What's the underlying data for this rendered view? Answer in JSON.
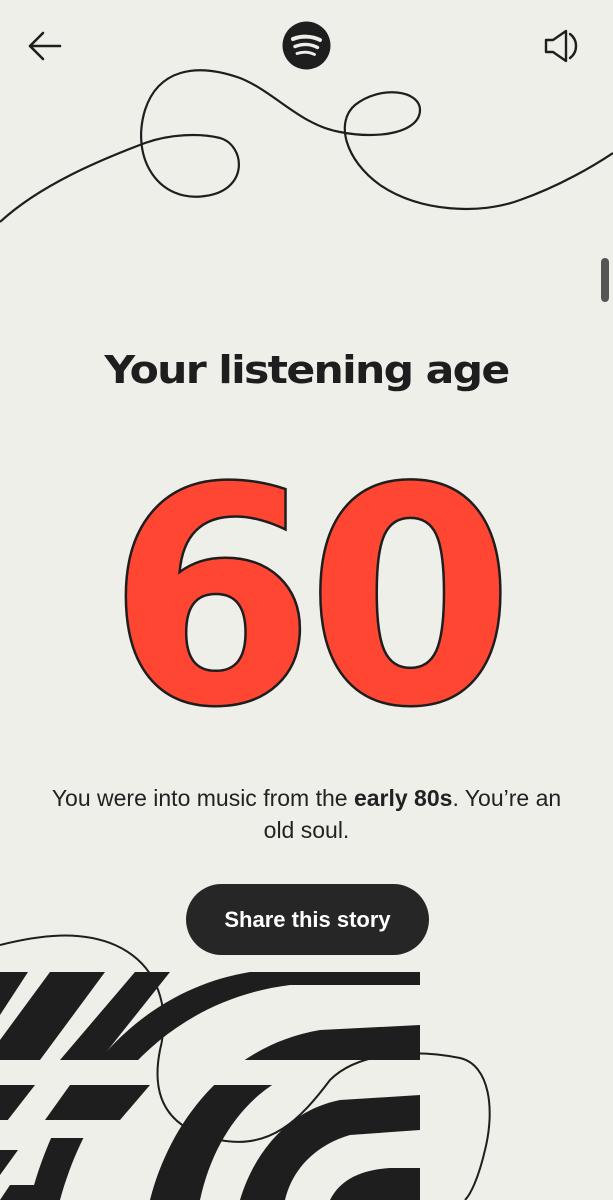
{
  "header": {
    "back_icon": "arrow-left-icon",
    "logo_icon": "spotify-logo-icon",
    "sound_icon": "speaker-icon"
  },
  "story": {
    "title": "Your listening age",
    "age": "60",
    "description_prefix": "You were into music from the ",
    "description_bold": "early 80s",
    "description_suffix": ". You’re an old soul.",
    "share_button": "Share this story"
  },
  "colors": {
    "background": "#eeefe9",
    "accent": "#ff4632",
    "dark": "#262626"
  }
}
